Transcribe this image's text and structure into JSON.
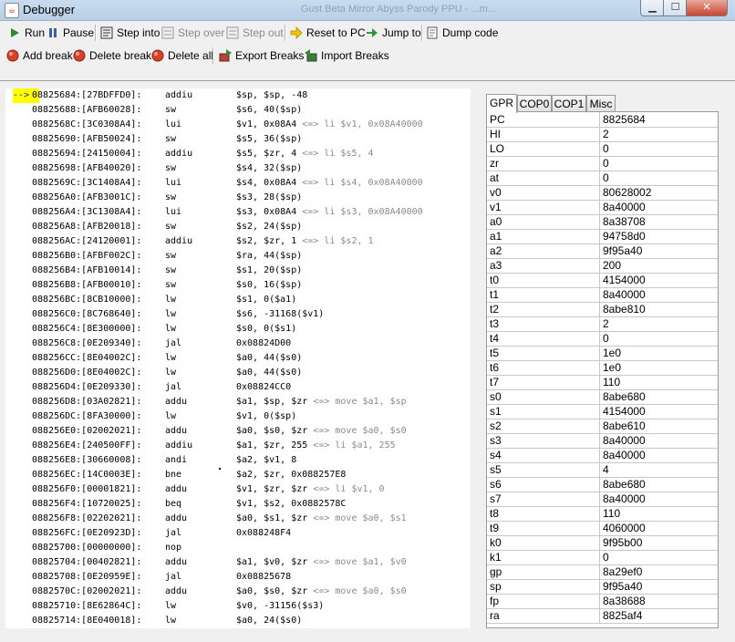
{
  "window": {
    "title": "Debugger",
    "background_title": "Gust Beta Mirror Abyss Parody PPU - ...m..."
  },
  "colors": {
    "pc_marker_bg": "#ffff00",
    "comment": "#8a8a8a",
    "close_button": "#c8452f"
  },
  "toolbar1": [
    {
      "id": "run",
      "label": "Run",
      "icon": "play-icon",
      "enabled": true
    },
    {
      "id": "pause",
      "label": "Pause",
      "icon": "pause-icon",
      "enabled": true
    },
    {
      "id": "step-into",
      "label": "Step into",
      "icon": "step-into-icon",
      "enabled": true
    },
    {
      "id": "step-over",
      "label": "Step over",
      "icon": "step-over-icon",
      "enabled": false
    },
    {
      "id": "step-out",
      "label": "Step out",
      "icon": "step-out-icon",
      "enabled": false
    },
    {
      "id": "reset-to-pc",
      "label": "Reset to PC",
      "icon": "arrow-right-icon",
      "enabled": true
    },
    {
      "id": "jump-to",
      "label": "Jump to",
      "icon": "jump-icon",
      "enabled": true
    },
    {
      "id": "dump-code",
      "label": "Dump code",
      "icon": "document-icon",
      "enabled": true
    }
  ],
  "toolbar2": [
    {
      "id": "add-break",
      "label": "Add break",
      "icon": "breakpoint-add-icon"
    },
    {
      "id": "delete-break",
      "label": "Delete break",
      "icon": "breakpoint-delete-icon"
    },
    {
      "id": "delete-all",
      "label": "Delete all",
      "icon": "breakpoint-delete-all-icon"
    },
    {
      "id": "export-breaks",
      "label": "Export Breaks",
      "icon": "export-icon"
    },
    {
      "id": "import-breaks",
      "label": "Import Breaks",
      "icon": "import-icon"
    }
  ],
  "pc_marker": "-->",
  "disassembly": [
    {
      "addr": "08825684:[27BDFFD0]:",
      "mn": "addiu",
      "op": "$sp, $sp, -48",
      "cm": ""
    },
    {
      "addr": "08825688:[AFB60028]:",
      "mn": "sw",
      "op": "$s6, 40($sp)",
      "cm": ""
    },
    {
      "addr": "0882568C:[3C0308A4]:",
      "mn": "lui",
      "op": "$v1, 0x08A4",
      "cm": " <=> li $v1, 0x08A40000"
    },
    {
      "addr": "08825690:[AFB50024]:",
      "mn": "sw",
      "op": "$s5, 36($sp)",
      "cm": ""
    },
    {
      "addr": "08825694:[24150004]:",
      "mn": "addiu",
      "op": "$s5, $zr, 4",
      "cm": " <=> li $s5, 4"
    },
    {
      "addr": "08825698:[AFB40020]:",
      "mn": "sw",
      "op": "$s4, 32($sp)",
      "cm": ""
    },
    {
      "addr": "0882569C:[3C1408A4]:",
      "mn": "lui",
      "op": "$s4, 0x08A4",
      "cm": " <=> li $s4, 0x08A40000"
    },
    {
      "addr": "088256A0:[AFB3001C]:",
      "mn": "sw",
      "op": "$s3, 28($sp)",
      "cm": ""
    },
    {
      "addr": "088256A4:[3C1308A4]:",
      "mn": "lui",
      "op": "$s3, 0x08A4",
      "cm": " <=> li $s3, 0x08A40000"
    },
    {
      "addr": "088256A8:[AFB20018]:",
      "mn": "sw",
      "op": "$s2, 24($sp)",
      "cm": ""
    },
    {
      "addr": "088256AC:[24120001]:",
      "mn": "addiu",
      "op": "$s2, $zr, 1",
      "cm": " <=> li $s2, 1"
    },
    {
      "addr": "088256B0:[AFBF002C]:",
      "mn": "sw",
      "op": "$ra, 44($sp)",
      "cm": ""
    },
    {
      "addr": "088256B4:[AFB10014]:",
      "mn": "sw",
      "op": "$s1, 20($sp)",
      "cm": ""
    },
    {
      "addr": "088256B8:[AFB00010]:",
      "mn": "sw",
      "op": "$s0, 16($sp)",
      "cm": ""
    },
    {
      "addr": "088256BC:[8CB10000]:",
      "mn": "lw",
      "op": "$s1, 0($a1)",
      "cm": ""
    },
    {
      "addr": "088256C0:[8C768640]:",
      "mn": "lw",
      "op": "$s6, -31168($v1)",
      "cm": ""
    },
    {
      "addr": "088256C4:[8E300000]:",
      "mn": "lw",
      "op": "$s0, 0($s1)",
      "cm": ""
    },
    {
      "addr": "088256C8:[0E209340]:",
      "mn": "jal",
      "op": "0x08824D00",
      "cm": ""
    },
    {
      "addr": "088256CC:[8E04002C]:",
      "mn": "lw",
      "op": "$a0, 44($s0)",
      "cm": ""
    },
    {
      "addr": "088256D0:[8E04002C]:",
      "mn": "lw",
      "op": "$a0, 44($s0)",
      "cm": ""
    },
    {
      "addr": "088256D4:[0E209330]:",
      "mn": "jal",
      "op": "0x08824CC0",
      "cm": ""
    },
    {
      "addr": "088256D8:[03A02821]:",
      "mn": "addu",
      "op": "$a1, $sp, $zr",
      "cm": " <=> move $a1, $sp"
    },
    {
      "addr": "088256DC:[8FA30000]:",
      "mn": "lw",
      "op": "$v1, 0($sp)",
      "cm": ""
    },
    {
      "addr": "088256E0:[02002021]:",
      "mn": "addu",
      "op": "$a0, $s0, $zr",
      "cm": " <=> move $a0, $s0"
    },
    {
      "addr": "088256E4:[240500FF]:",
      "mn": "addiu",
      "op": "$a1, $zr, 255",
      "cm": " <=> li $a1, 255"
    },
    {
      "addr": "088256E8:[30660008]:",
      "mn": "andi",
      "op": "$a2, $v1, 8",
      "cm": ""
    },
    {
      "addr": "088256EC:[14C0003E]:",
      "mn": "bne",
      "op": "$a2, $zr, 0x088257E8",
      "cm": ""
    },
    {
      "addr": "088256F0:[00001821]:",
      "mn": "addu",
      "op": "$v1, $zr, $zr",
      "cm": " <=> li $v1, 0"
    },
    {
      "addr": "088256F4:[10720025]:",
      "mn": "beq",
      "op": "$v1, $s2, 0x0882578C",
      "cm": ""
    },
    {
      "addr": "088256F8:[02202021]:",
      "mn": "addu",
      "op": "$a0, $s1, $zr",
      "cm": " <=> move $a0, $s1"
    },
    {
      "addr": "088256FC:[0E20923D]:",
      "mn": "jal",
      "op": "0x088248F4",
      "cm": ""
    },
    {
      "addr": "08825700:[00000000]:",
      "mn": "nop",
      "op": "",
      "cm": ""
    },
    {
      "addr": "08825704:[00402821]:",
      "mn": "addu",
      "op": "$a1, $v0, $zr",
      "cm": " <=> move $a1, $v0"
    },
    {
      "addr": "08825708:[0E20959E]:",
      "mn": "jal",
      "op": "0x08825678",
      "cm": ""
    },
    {
      "addr": "0882570C:[02002021]:",
      "mn": "addu",
      "op": "$a0, $s0, $zr",
      "cm": " <=> move $a0, $s0"
    },
    {
      "addr": "08825710:[8E62864C]:",
      "mn": "lw",
      "op": "$v0, -31156($s3)",
      "cm": ""
    },
    {
      "addr": "08825714:[8E040018]:",
      "mn": "lw",
      "op": "$a0, 24($s0)",
      "cm": ""
    }
  ],
  "tabs": [
    {
      "label": "GPR",
      "active": true
    },
    {
      "label": "COP0",
      "active": false
    },
    {
      "label": "COP1",
      "active": false
    },
    {
      "label": "Misc",
      "active": false
    }
  ],
  "registers": [
    {
      "name": "PC",
      "value": "8825684"
    },
    {
      "name": "HI",
      "value": "2"
    },
    {
      "name": "LO",
      "value": "0"
    },
    {
      "name": "zr",
      "value": "0"
    },
    {
      "name": "at",
      "value": "0"
    },
    {
      "name": "v0",
      "value": "80628002"
    },
    {
      "name": "v1",
      "value": "8a40000"
    },
    {
      "name": "a0",
      "value": "8a38708"
    },
    {
      "name": "a1",
      "value": "94758d0"
    },
    {
      "name": "a2",
      "value": "9f95a40"
    },
    {
      "name": "a3",
      "value": "200"
    },
    {
      "name": "t0",
      "value": "4154000"
    },
    {
      "name": "t1",
      "value": "8a40000"
    },
    {
      "name": "t2",
      "value": "8abe810"
    },
    {
      "name": "t3",
      "value": "2"
    },
    {
      "name": "t4",
      "value": "0"
    },
    {
      "name": "t5",
      "value": "1e0"
    },
    {
      "name": "t6",
      "value": "1e0"
    },
    {
      "name": "t7",
      "value": "110"
    },
    {
      "name": "s0",
      "value": "8abe680"
    },
    {
      "name": "s1",
      "value": "4154000"
    },
    {
      "name": "s2",
      "value": "8abe610"
    },
    {
      "name": "s3",
      "value": "8a40000"
    },
    {
      "name": "s4",
      "value": "8a40000"
    },
    {
      "name": "s5",
      "value": "4"
    },
    {
      "name": "s6",
      "value": "8abe680"
    },
    {
      "name": "s7",
      "value": "8a40000"
    },
    {
      "name": "t8",
      "value": "110"
    },
    {
      "name": "t9",
      "value": "4060000"
    },
    {
      "name": "k0",
      "value": "9f95b00"
    },
    {
      "name": "k1",
      "value": "0"
    },
    {
      "name": "gp",
      "value": "8a29ef0"
    },
    {
      "name": "sp",
      "value": "9f95a40"
    },
    {
      "name": "fp",
      "value": "8a38688"
    },
    {
      "name": "ra",
      "value": "8825af4"
    }
  ]
}
